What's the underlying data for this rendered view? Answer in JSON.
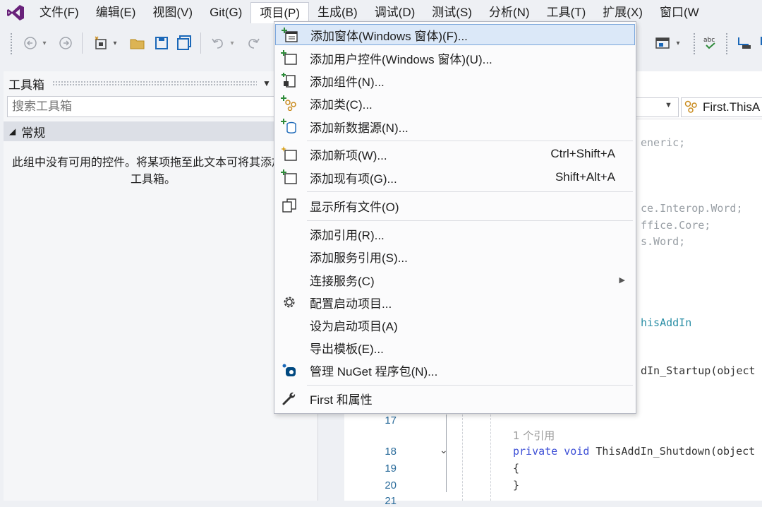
{
  "menubar": {
    "items": [
      "文件(F)",
      "编辑(E)",
      "视图(V)",
      "Git(G)",
      "项目(P)",
      "生成(B)",
      "调试(D)",
      "测试(S)",
      "分析(N)",
      "工具(T)",
      "扩展(X)",
      "窗口(W"
    ],
    "open_item": "项目(P)"
  },
  "toolbox": {
    "title": "工具箱",
    "search_placeholder": "搜索工具箱",
    "group_label": "常规",
    "empty_message": "此组中没有可用的控件。将某项拖至此文本可将其添加到工具箱。"
  },
  "editor": {
    "nav_right": "First.ThisA",
    "code_lines": {
      "l1": "eneric;",
      "l2": "ce.Interop.Word;",
      "l3": "ffice.Core;",
      "l4": "s.Word;",
      "l5": "hisAddIn",
      "l6": "dIn_Startup(object",
      "ref_count": "1 个引用",
      "kw_private": "private",
      "kw_void": "void",
      "shutdown": "ThisAddIn_Shutdown(object",
      "open_brace": "{",
      "close_brace": "}"
    },
    "line_numbers": [
      "17",
      "18",
      "19",
      "20",
      "21"
    ]
  },
  "dropdown": {
    "items": [
      {
        "label": "添加窗体(Windows 窗体)(F)...",
        "icon": "add-form-icon",
        "shortcut": ""
      },
      {
        "label": "添加用户控件(Windows 窗体)(U)...",
        "icon": "add-user-control-icon",
        "shortcut": ""
      },
      {
        "label": "添加组件(N)...",
        "icon": "add-component-icon",
        "shortcut": ""
      },
      {
        "label": "添加类(C)...",
        "icon": "add-class-icon",
        "shortcut": ""
      },
      {
        "label": "添加新数据源(N)...",
        "icon": "add-datasource-icon",
        "shortcut": ""
      },
      {
        "label": "添加新项(W)...",
        "icon": "add-new-item-icon",
        "shortcut": "Ctrl+Shift+A"
      },
      {
        "label": "添加现有项(G)...",
        "icon": "add-existing-item-icon",
        "shortcut": "Shift+Alt+A"
      },
      {
        "label": "显示所有文件(O)",
        "icon": "show-all-files-icon",
        "shortcut": ""
      },
      {
        "label": "添加引用(R)...",
        "icon": "",
        "shortcut": ""
      },
      {
        "label": "添加服务引用(S)...",
        "icon": "",
        "shortcut": ""
      },
      {
        "label": "连接服务(C)",
        "icon": "",
        "shortcut": ""
      },
      {
        "label": "配置启动项目...",
        "icon": "gear-icon",
        "shortcut": ""
      },
      {
        "label": "设为启动项目(A)",
        "icon": "",
        "shortcut": ""
      },
      {
        "label": "导出模板(E)...",
        "icon": "",
        "shortcut": ""
      },
      {
        "label": "管理 NuGet 程序包(N)...",
        "icon": "nuget-icon",
        "shortcut": ""
      },
      {
        "label": "First 和属性",
        "icon": "wrench-icon",
        "shortcut": ""
      }
    ]
  },
  "colors": {
    "accent": "#68217a",
    "highlight_bg": "#dbe8f8",
    "highlight_border": "#7aa6dc",
    "keyword": "#3d4fd6"
  }
}
